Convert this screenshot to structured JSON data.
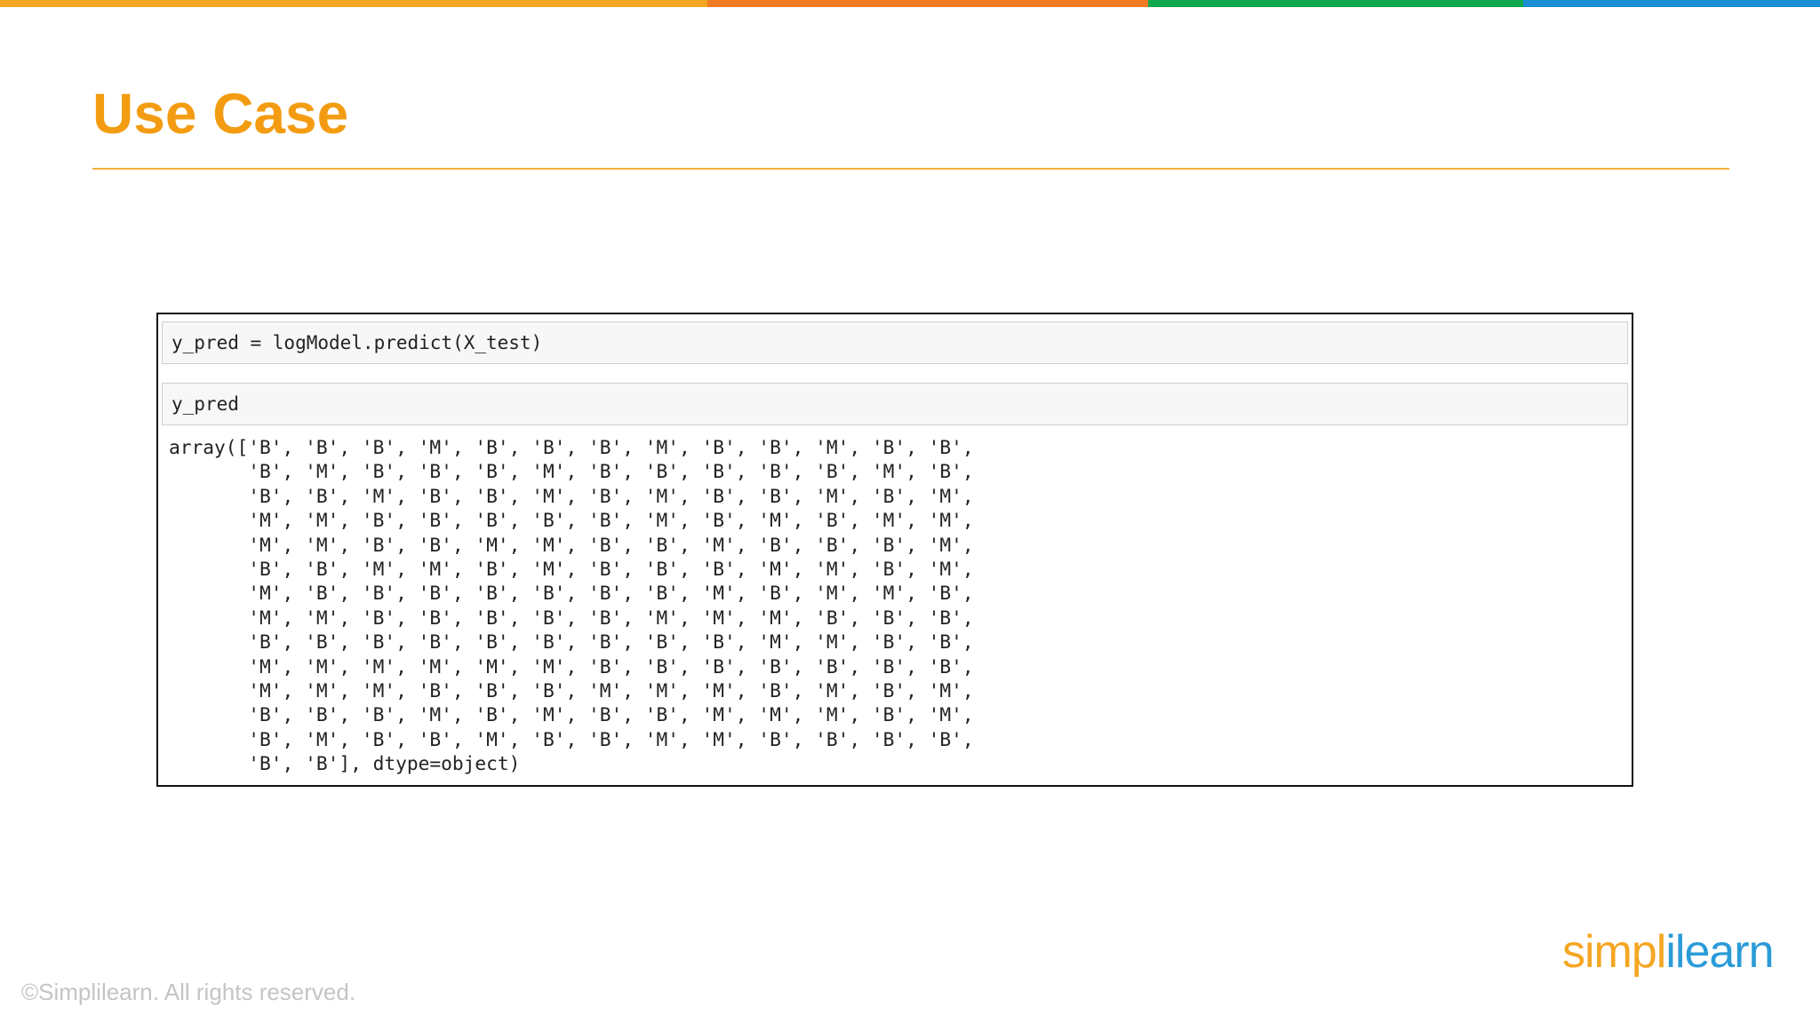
{
  "brand": {
    "colors": {
      "top_bar": [
        "#f5a623",
        "#f07b24",
        "#12a94e",
        "#1a8fd6"
      ],
      "title": "#f39c12",
      "title_rule": "#f3b23a",
      "logo_left": "#f5a623",
      "logo_right": "#2b9bd8"
    }
  },
  "slide": {
    "title": "Use Case"
  },
  "notebook": {
    "cell_1_code": "y_pred = logModel.predict(X_test)",
    "cell_2_code": "y_pred",
    "output_lines": [
      "array(['B', 'B', 'B', 'M', 'B', 'B', 'B', 'M', 'B', 'B', 'M', 'B', 'B',",
      "       'B', 'M', 'B', 'B', 'B', 'M', 'B', 'B', 'B', 'B', 'B', 'M', 'B',",
      "       'B', 'B', 'M', 'B', 'B', 'M', 'B', 'M', 'B', 'B', 'M', 'B', 'M',",
      "       'M', 'M', 'B', 'B', 'B', 'B', 'B', 'M', 'B', 'M', 'B', 'M', 'M',",
      "       'M', 'M', 'B', 'B', 'M', 'M', 'B', 'B', 'M', 'B', 'B', 'B', 'M',",
      "       'B', 'B', 'M', 'M', 'B', 'M', 'B', 'B', 'B', 'M', 'M', 'B', 'M',",
      "       'M', 'B', 'B', 'B', 'B', 'B', 'B', 'B', 'M', 'B', 'M', 'M', 'B',",
      "       'M', 'M', 'B', 'B', 'B', 'B', 'B', 'M', 'M', 'M', 'B', 'B', 'B',",
      "       'B', 'B', 'B', 'B', 'B', 'B', 'B', 'B', 'B', 'M', 'M', 'B', 'B',",
      "       'M', 'M', 'M', 'M', 'M', 'M', 'B', 'B', 'B', 'B', 'B', 'B', 'B',",
      "       'M', 'M', 'M', 'B', 'B', 'B', 'M', 'M', 'M', 'B', 'M', 'B', 'M',",
      "       'B', 'B', 'B', 'M', 'B', 'M', 'B', 'B', 'M', 'M', 'M', 'B', 'M',",
      "       'B', 'M', 'B', 'B', 'M', 'B', 'B', 'M', 'M', 'B', 'B', 'B', 'B',",
      "       'B', 'B'], dtype=object)"
    ]
  },
  "footer": {
    "copyright": "©Simplilearn. All rights reserved.",
    "logo_left": "simpl",
    "logo_right": "ilearn"
  }
}
